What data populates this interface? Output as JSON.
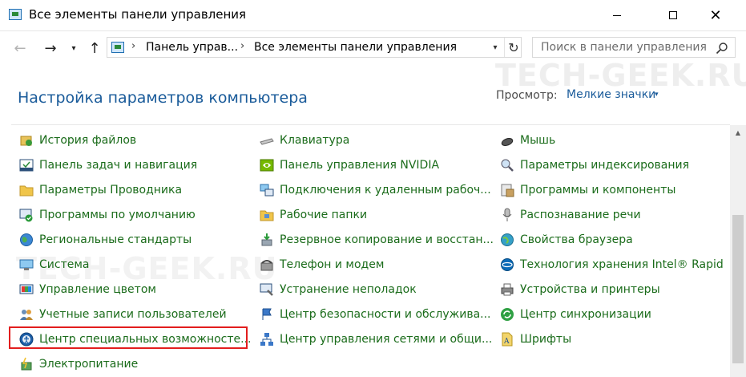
{
  "window": {
    "title": "Все элементы панели управления",
    "close_glyph": "✕"
  },
  "nav": {
    "back_glyph": "←",
    "forward_glyph": "→",
    "dropdown_glyph": "▾",
    "up_glyph": "↑",
    "breadcrumbs": [
      "Панель управ...",
      "Все элементы панели управления"
    ],
    "crumb_separator": "›",
    "refresh_glyph": "↻",
    "address_dropdown_glyph": "▾"
  },
  "search": {
    "placeholder": "Поиск в панели управления"
  },
  "watermark": "TECH-GEEK.RU",
  "header": {
    "title": "Настройка параметров компьютера",
    "view_label": "Просмотр:",
    "view_value": "Мелкие значки",
    "view_caret": "▾"
  },
  "columns": [
    {
      "items": [
        {
          "label": "История файлов",
          "icon": "file-history-icon"
        },
        {
          "label": "Панель задач и навигация",
          "icon": "taskbar-icon"
        },
        {
          "label": "Параметры Проводника",
          "icon": "folder-options-icon"
        },
        {
          "label": "Программы по умолчанию",
          "icon": "default-programs-icon"
        },
        {
          "label": "Региональные стандарты",
          "icon": "region-icon"
        },
        {
          "label": "Система",
          "icon": "system-icon"
        },
        {
          "label": "Управление цветом",
          "icon": "color-management-icon"
        },
        {
          "label": "Учетные записи пользователей",
          "icon": "user-accounts-icon"
        },
        {
          "label": "Центр специальных возможносте...",
          "icon": "ease-of-access-icon"
        },
        {
          "label": "Электропитание",
          "icon": "power-options-icon"
        }
      ]
    },
    {
      "items": [
        {
          "label": "Клавиатура",
          "icon": "keyboard-icon"
        },
        {
          "label": "Панель управления NVIDIA",
          "icon": "nvidia-icon"
        },
        {
          "label": "Подключения к удаленным рабоч...",
          "icon": "remote-connections-icon"
        },
        {
          "label": "Рабочие папки",
          "icon": "work-folders-icon"
        },
        {
          "label": "Резервное копирование и восстан...",
          "icon": "backup-restore-icon"
        },
        {
          "label": "Телефон и модем",
          "icon": "phone-modem-icon"
        },
        {
          "label": "Устранение неполадок",
          "icon": "troubleshooting-icon"
        },
        {
          "label": "Центр безопасности и обслужива...",
          "icon": "security-center-icon"
        },
        {
          "label": "Центр управления сетями и общи...",
          "icon": "network-center-icon"
        }
      ]
    },
    {
      "items": [
        {
          "label": "Мышь",
          "icon": "mouse-icon"
        },
        {
          "label": "Параметры индексирования",
          "icon": "indexing-icon"
        },
        {
          "label": "Программы и компоненты",
          "icon": "programs-features-icon"
        },
        {
          "label": "Распознавание речи",
          "icon": "speech-recognition-icon"
        },
        {
          "label": "Свойства браузера",
          "icon": "internet-options-icon"
        },
        {
          "label": "Технология хранения Intel® Rapid",
          "icon": "intel-rst-icon"
        },
        {
          "label": "Устройства и принтеры",
          "icon": "devices-printers-icon"
        },
        {
          "label": "Центр синхронизации",
          "icon": "sync-center-icon"
        },
        {
          "label": "Шрифты",
          "icon": "fonts-icon"
        }
      ]
    }
  ],
  "highlighted_item": "Центр специальных возможносте...",
  "colors": {
    "link_green": "#1b6c1b",
    "heading_blue": "#1a5b9a",
    "highlight_red": "#e21e1e"
  }
}
